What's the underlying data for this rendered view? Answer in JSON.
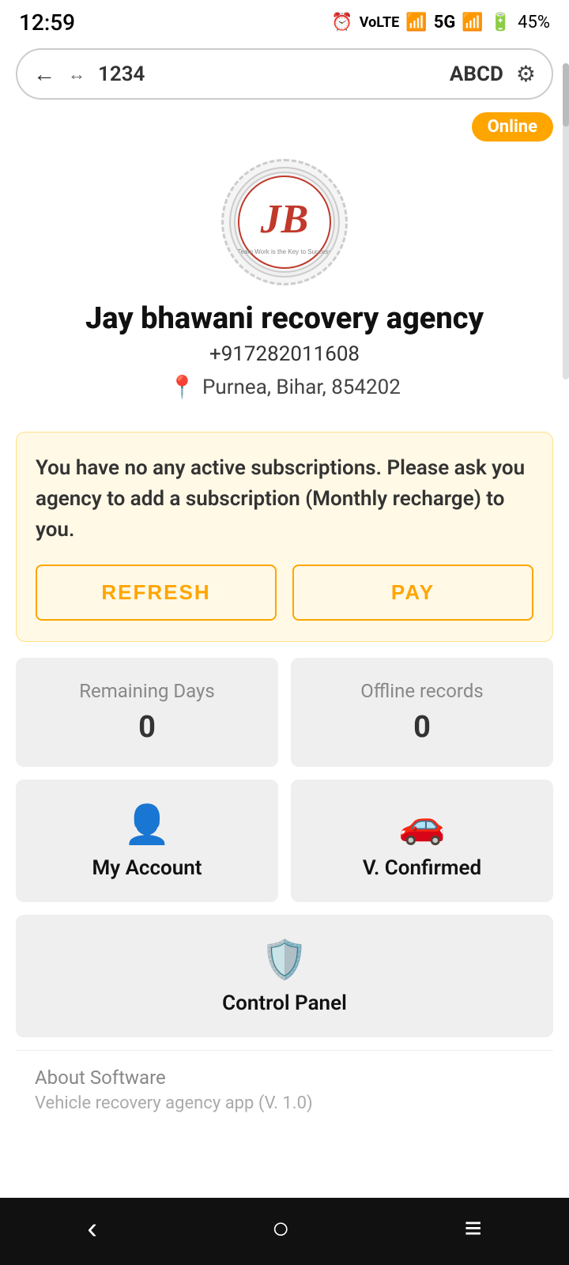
{
  "statusBar": {
    "time": "12:59",
    "battery": "45%",
    "network": "5G"
  },
  "browserBar": {
    "url": "1234",
    "domain": "ABCD"
  },
  "onlineBadge": "Online",
  "profile": {
    "name": "Jay bhawani recovery agency",
    "phone": "+917282011608",
    "location": "Purnea, Bihar, 854202"
  },
  "subscription": {
    "message": "You have no any active subscriptions. Please ask you agency to add a subscription (Monthly recharge) to you.",
    "refreshLabel": "REFRESH",
    "payLabel": "PAY"
  },
  "stats": {
    "remainingDaysLabel": "Remaining Days",
    "remainingDaysValue": "0",
    "offlineRecordsLabel": "Offline records",
    "offlineRecordsValue": "0"
  },
  "actions": {
    "myAccountLabel": "My Account",
    "vConfirmedLabel": "V. Confirmed",
    "controlPanelLabel": "Control Panel"
  },
  "about": {
    "title": "About Software",
    "subtitle": "Vehicle recovery agency app (V. 1.0)"
  },
  "bottomNav": {
    "backIcon": "‹",
    "homeIcon": "○",
    "menuIcon": "≡"
  }
}
